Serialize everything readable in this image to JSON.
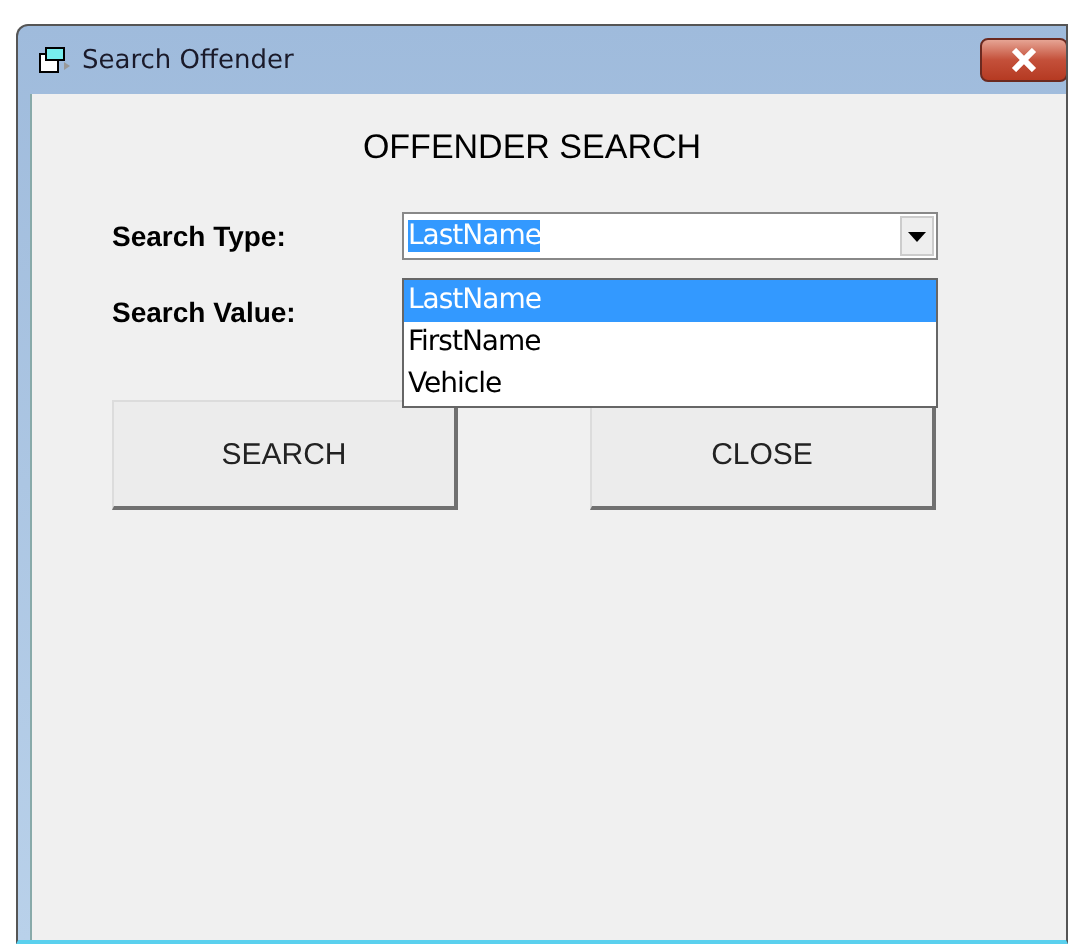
{
  "window": {
    "title": "Search Offender"
  },
  "heading": "OFFENDER SEARCH",
  "search_type": {
    "label": "Search Type:",
    "value": "LastName",
    "expanded": true,
    "options": [
      {
        "label": "LastName",
        "selected": true
      },
      {
        "label": "FirstName",
        "selected": false
      },
      {
        "label": "Vehicle",
        "selected": false
      }
    ]
  },
  "search_value": {
    "label": "Search Value:"
  },
  "buttons": [
    {
      "label": "SEARCH"
    },
    {
      "label": "CLOSE"
    }
  ]
}
